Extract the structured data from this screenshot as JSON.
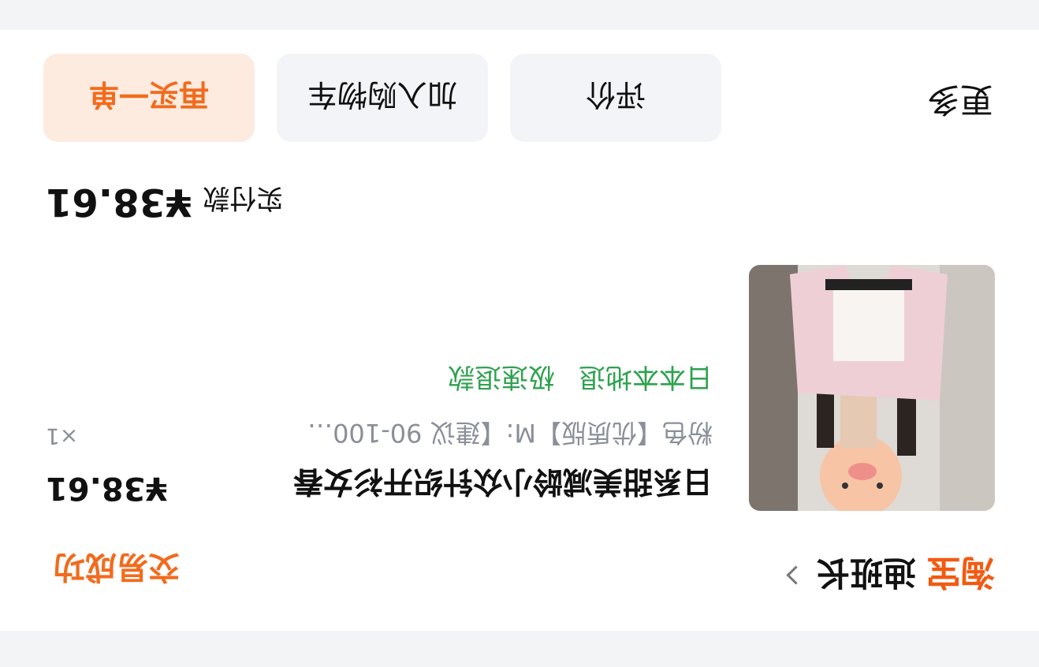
{
  "order": {
    "shop": {
      "platform_logo": "淘宝",
      "name": "迪班长"
    },
    "status": "交易成功",
    "product": {
      "title": "日系甜美减龄小众针织开衫女春",
      "price": "¥38.61",
      "spec": "粉色【优质版】M:【建议 90-100…",
      "quantity": "×1",
      "tags": [
        "日本本地退",
        "极速退款"
      ]
    },
    "payment": {
      "label": "实付款",
      "amount": "¥38.61"
    },
    "actions": {
      "more": "更多",
      "review": "评价",
      "add_to_cart": "加入购物车",
      "rebuy": "再买一单"
    }
  },
  "colors": {
    "brand_orange": "#f26b1d",
    "tag_green": "#2fa24f",
    "page_bg": "#f3f4f6"
  }
}
